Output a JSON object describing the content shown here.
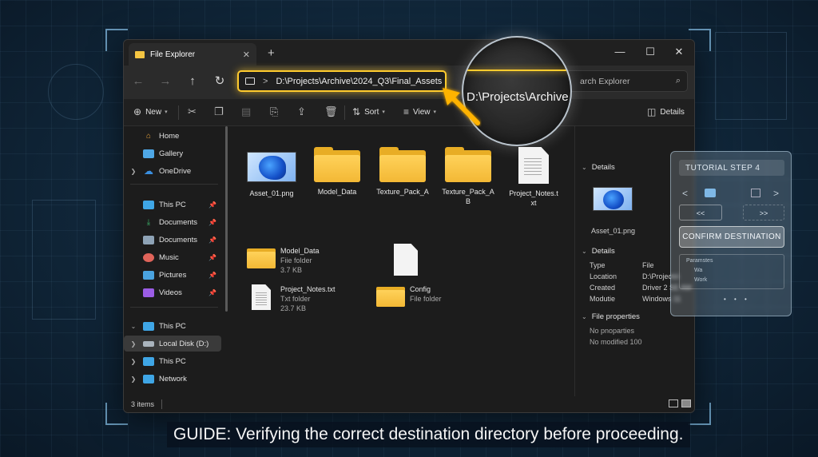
{
  "window": {
    "tab_title": "File Explorer",
    "tab_close": "✕",
    "new_tab": "+",
    "controls": {
      "minimize": "—",
      "maximize": "☐",
      "close": "✕"
    }
  },
  "nav": {
    "back": "←",
    "forward": "→",
    "up": "↑",
    "refresh": "↻"
  },
  "address": {
    "separator": ">",
    "path": "D:\\Projects\\Archive\\2024_Q3\\Final_Assets"
  },
  "search": {
    "placeholder": "Search Explorer",
    "visible_text": "arch Explorer"
  },
  "toolbar": {
    "new_label": "New",
    "sort_label": "Sort",
    "view_label": "View",
    "details_label": "Details"
  },
  "sidebar": {
    "items": [
      {
        "label": "Home",
        "icon": "home-icon",
        "color": "#e8a33b"
      },
      {
        "label": "Gallery",
        "icon": "gallery-icon",
        "color": "#4ea7e6"
      },
      {
        "label": "OneDrive",
        "icon": "cloud-icon",
        "color": "#3a8fe0"
      },
      {
        "label": "This PC",
        "icon": "monitor-icon",
        "color": "#3fa6e6"
      },
      {
        "label": "Documents",
        "icon": "download-icon",
        "color": "#3db56a"
      },
      {
        "label": "Documents",
        "icon": "documents-icon",
        "color": "#8ea3b6"
      },
      {
        "label": "Music",
        "icon": "music-icon",
        "color": "#e0645a"
      },
      {
        "label": "Pictures",
        "icon": "pictures-icon",
        "color": "#4aa3e0"
      },
      {
        "label": "Videos",
        "icon": "videos-icon",
        "color": "#9b5de5"
      },
      {
        "label": "This PC",
        "icon": "monitor-icon",
        "color": "#3fa6e6"
      },
      {
        "label": "Local Disk (D:)",
        "icon": "disk-icon",
        "color": "#aab4bd"
      },
      {
        "label": "This PC",
        "icon": "monitor-icon",
        "color": "#3fa6e6"
      },
      {
        "label": "Network",
        "icon": "network-icon",
        "color": "#3fa6e6"
      }
    ]
  },
  "grid_items": [
    {
      "name": "Asset_01.png",
      "kind": "image"
    },
    {
      "name": "Model_Data",
      "kind": "folder"
    },
    {
      "name": "Texture_Pack_A",
      "kind": "folder"
    },
    {
      "name": "Texture_Pack_A B",
      "line1": "Texture_Pack_A",
      "line2": "B",
      "kind": "folder"
    },
    {
      "name": "Project_Notes.txt",
      "line1": "Project_Notes.t",
      "line2": "xt",
      "kind": "document"
    }
  ],
  "list_items": [
    {
      "name": "Model_Data",
      "type": "Fiie folder",
      "size": "3.7 KB"
    },
    {
      "name": "Project_Notes.txt",
      "type": "Txt folder",
      "size": "23.7 KB"
    },
    {
      "name": "Config",
      "type": "File folder"
    }
  ],
  "details_pane": {
    "header1": "Details",
    "preview_name": "Asset_01.png",
    "header2": "Details",
    "rows": [
      {
        "label": "Type",
        "value": "File"
      },
      {
        "label": "Location",
        "value": "D:\\Projects\\"
      },
      {
        "label": "Created",
        "value": "Driver 2 SE AM"
      },
      {
        "label": "Modutie",
        "value": "Windows 11"
      }
    ],
    "header3": "File properties",
    "prop1": "No pnoparties",
    "prop2": "No modified 100"
  },
  "status": {
    "items_count": "3 items"
  },
  "magnifier": {
    "text": "D:\\Projects\\Archive"
  },
  "tutorial": {
    "title": "TUTORIAL STEP 4",
    "back_glyph": "<",
    "forward_glyph": ">",
    "pill_left": "<<",
    "pill_right": ">>",
    "confirm_label": "CONFIRM DESTINATION",
    "box_line1": "Paramstes",
    "box_line2": "Wa",
    "box_line3": "Work",
    "dots": "• • •"
  },
  "caption": "GUIDE: Verifying the correct destination directory before proceeding.",
  "colors": {
    "highlight": "#ffcb2e",
    "folder": "#f3b835",
    "window_bg": "#1c1c1c"
  }
}
